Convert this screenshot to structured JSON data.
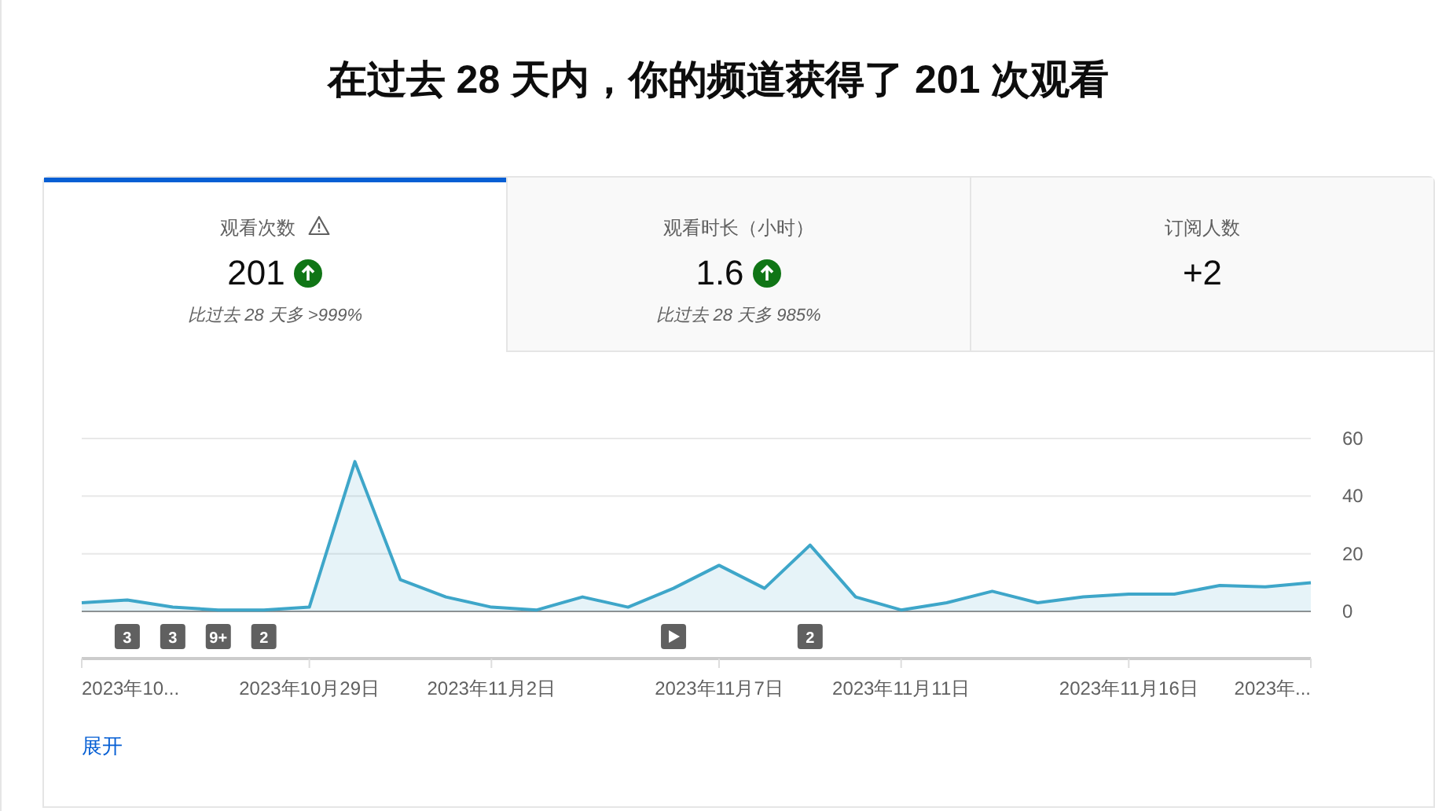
{
  "heading": "在过去 28 天内，你的频道获得了 201 次观看",
  "tabs": [
    {
      "label": "观看次数",
      "warning": true,
      "value": "201",
      "rising": true,
      "comparison": "比过去 28 天多 >999%",
      "selected": true
    },
    {
      "label": "观看时长（小时）",
      "warning": false,
      "value": "1.6",
      "rising": true,
      "comparison": "比过去 28 天多 985%",
      "selected": false
    },
    {
      "label": "订阅人数",
      "warning": false,
      "value": "+2",
      "rising": false,
      "selected": false
    }
  ],
  "chart": {
    "chart_data": {
      "type": "area",
      "categories": [
        null,
        null,
        null,
        null,
        null,
        "2023年10月29日",
        null,
        null,
        null,
        "2023年11月2日",
        null,
        null,
        null,
        null,
        "2023年11月7日",
        null,
        null,
        null,
        "2023年11月11日",
        null,
        null,
        null,
        null,
        "2023年11月16日",
        null,
        null,
        null,
        null
      ],
      "series": [
        {
          "color": "#3ea6c9",
          "values": [
            3,
            4,
            1.5,
            0.5,
            0.5,
            1.5,
            52,
            11,
            5,
            1.5,
            0.5,
            5,
            1.5,
            8,
            16,
            8,
            23,
            5,
            0.5,
            3,
            7,
            3,
            5,
            6,
            6,
            9,
            8.5,
            10
          ]
        }
      ],
      "ylim": [
        0,
        60
      ],
      "yticks": [
        0,
        20,
        40,
        60
      ]
    },
    "axis_start_label": "2023年10...",
    "axis_end_label": "2023年...",
    "marker_slots": [
      {
        "kind": "none"
      },
      {
        "kind": "count",
        "text": "3"
      },
      {
        "kind": "count",
        "text": "3"
      },
      {
        "kind": "count",
        "text": "9+"
      },
      {
        "kind": "count",
        "text": "2"
      },
      {
        "kind": "none"
      },
      {
        "kind": "none"
      },
      {
        "kind": "none"
      },
      {
        "kind": "none"
      },
      {
        "kind": "none"
      },
      {
        "kind": "none"
      },
      {
        "kind": "none"
      },
      {
        "kind": "none"
      },
      {
        "kind": "video"
      },
      {
        "kind": "none"
      },
      {
        "kind": "none"
      },
      {
        "kind": "count",
        "text": "2"
      },
      {
        "kind": "none"
      },
      {
        "kind": "none"
      },
      {
        "kind": "none"
      },
      {
        "kind": "none"
      },
      {
        "kind": "none"
      },
      {
        "kind": "none"
      },
      {
        "kind": "none"
      },
      {
        "kind": "none"
      },
      {
        "kind": "none"
      },
      {
        "kind": "none"
      },
      {
        "kind": "none"
      }
    ]
  },
  "expand_link": "展开"
}
